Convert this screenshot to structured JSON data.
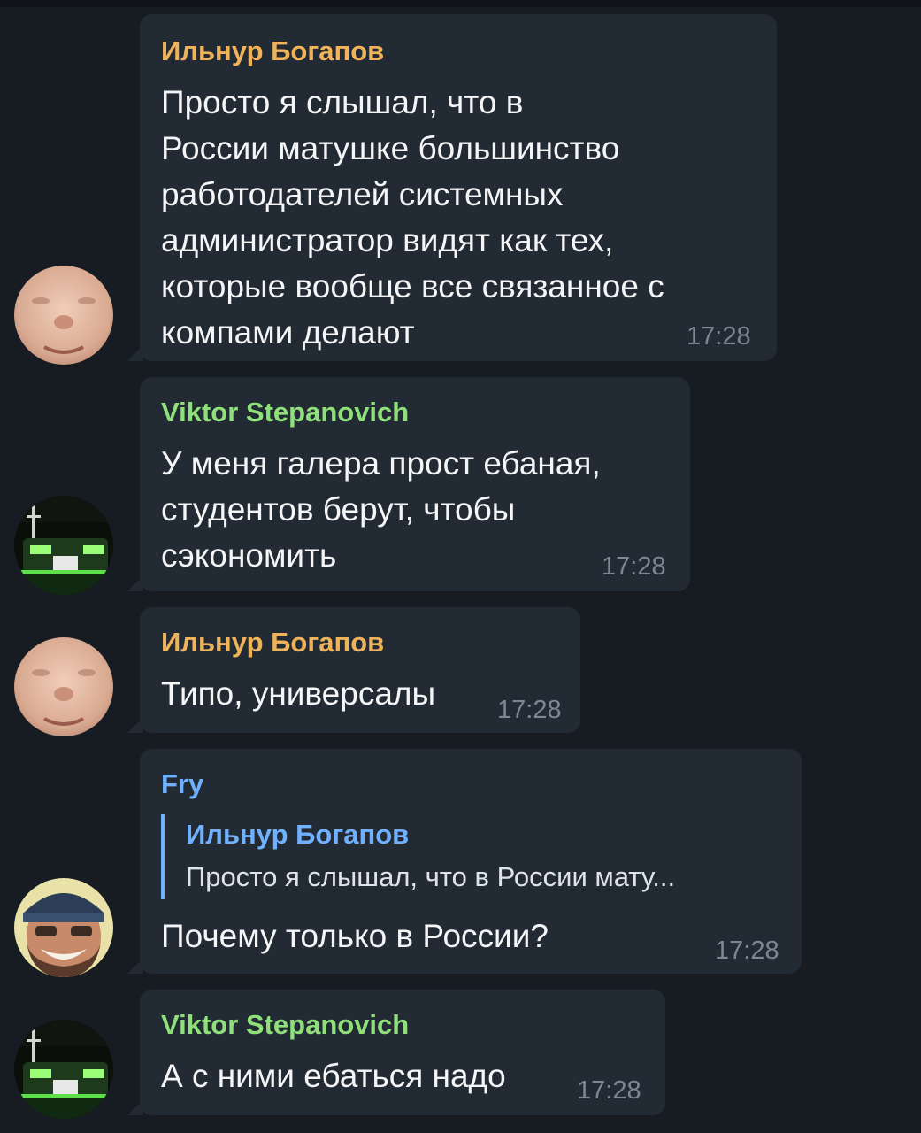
{
  "colors": {
    "background": "#171c23",
    "bubble": "#222a33",
    "sender_orange": "#f0b35a",
    "sender_green": "#8fe07a",
    "sender_blue": "#6fb1ff",
    "timestamp": "#7b8794"
  },
  "messages": [
    {
      "sender": "Ильнур Богапов",
      "text": "Просто я слышал, что в\nРоссии матушке большинство\nработодателей системных\nадминистратор видят как тех,\nкоторые вообще все связанное с\nкомпами делают",
      "time": "17:28",
      "avatar": "face-avatar"
    },
    {
      "sender": "Viktor Stepanovich",
      "text": "У меня галера прост ебаная,\nстудентов берут, чтобы\nсэкономить",
      "time": "17:28",
      "avatar": "car-avatar"
    },
    {
      "sender": "Ильнур Богапов",
      "text": "Типо, универсалы",
      "time": "17:28",
      "avatar": "face-avatar"
    },
    {
      "sender": "Fry",
      "reply_to": {
        "sender": "Ильнур Богапов",
        "text": "Просто я слышал, что в России мату..."
      },
      "text": "Почему только в России?",
      "time": "17:28",
      "avatar": "beanie-avatar"
    },
    {
      "sender": "Viktor Stepanovich",
      "text": "А с ними ебаться надо",
      "time": "17:28",
      "avatar": "car-avatar"
    }
  ]
}
